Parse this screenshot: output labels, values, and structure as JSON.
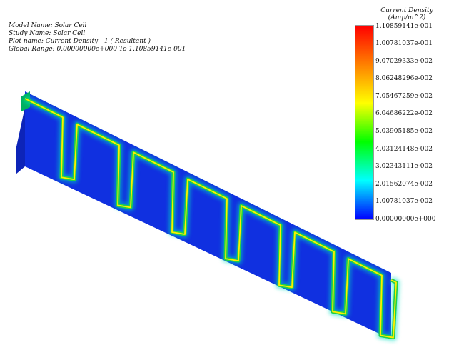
{
  "plot_info": {
    "model_name": "Model Name: Solar Cell",
    "study_name": "Study Name: Solar Cell",
    "plot_name": "Plot name: Current Density - 1 ( Resultant )",
    "global_range": "Global Range: 0.00000000e+000 To 1.10859141e-001"
  },
  "legend": {
    "title_line1": "Current Density",
    "title_line2": "(Amp/m^2)",
    "labels": [
      "1.10859141e-001",
      "1.00781037e-001",
      "9.07029333e-002",
      "8.06248296e-002",
      "7.05467259e-002",
      "6.04686222e-002",
      "5.03905185e-002",
      "4.03124148e-002",
      "3.02343111e-002",
      "2.01562074e-002",
      "1.00781037e-002",
      "0.00000000e+000"
    ],
    "colors": [
      "#ff0000",
      "#ff8000",
      "#ffff00",
      "#00ff00",
      "#00ffff",
      "#0000ff"
    ]
  },
  "model": {
    "base_color": "#1030e0",
    "side_color": "#0d24b8",
    "edge_color": "#00b060",
    "slot_count": 7
  }
}
